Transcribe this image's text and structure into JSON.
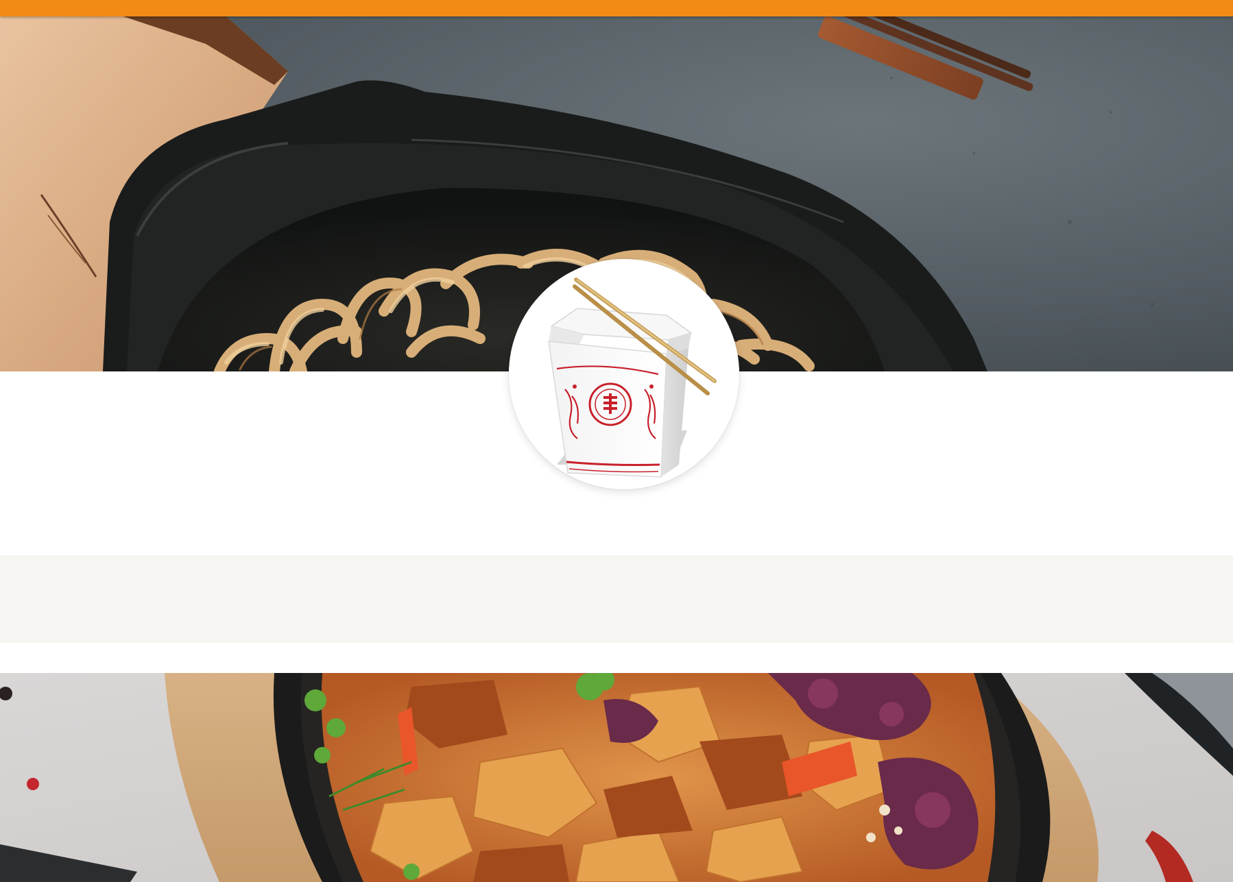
{
  "header": {
    "accent_color": "#f28a16"
  },
  "hero": {
    "image": "noodles-in-black-clay-pot-with-chopsticks",
    "background_color": "#505a60"
  },
  "logo": {
    "image": "chinese-takeout-box-with-chopsticks-logo",
    "box_print_color": "#c8202a"
  },
  "band": {
    "background_color": "#f6f5f2"
  },
  "lower_image": {
    "image": "braised-potato-chicken-on-cast-iron-skillet"
  }
}
